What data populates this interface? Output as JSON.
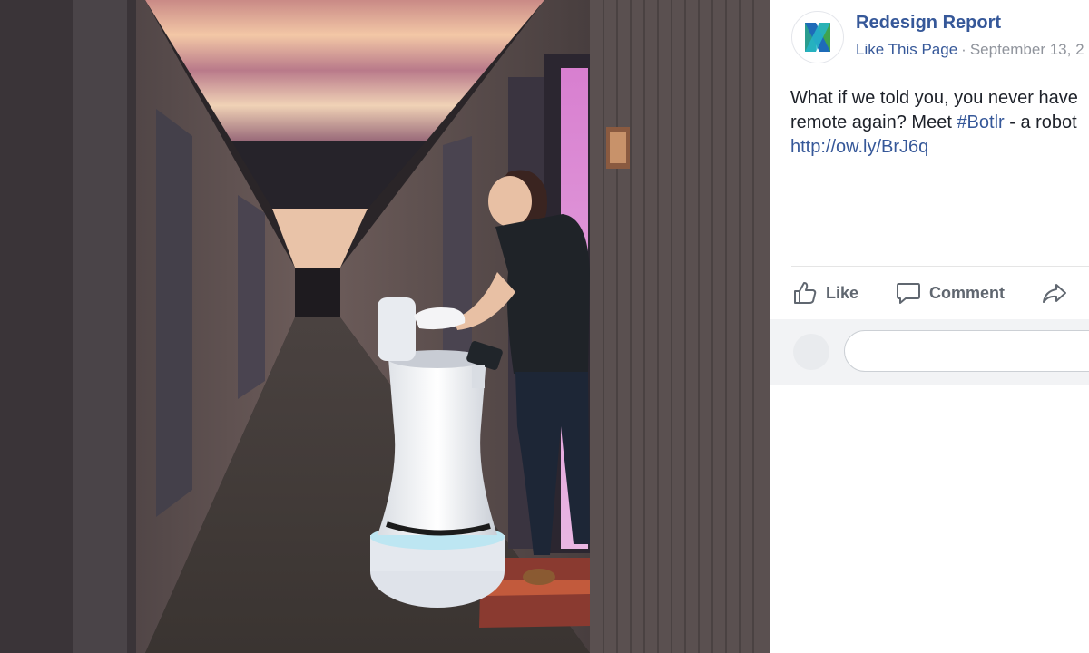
{
  "photo": {
    "description_icon": "hotel-hallway-robot-photo"
  },
  "post": {
    "page_name": "Redesign Report",
    "like_page_label": "Like This Page",
    "separator": "·",
    "date": "September 13, 2",
    "text_line1": "What if we told you, you never have",
    "text_line2_prefix": "remote again? Meet ",
    "hashtag": "#Botlr",
    "text_line2_suffix": " - a robot",
    "link": "http://ow.ly/BrJ6q"
  },
  "actions": {
    "like_label": "Like",
    "comment_label": "Comment",
    "like_icon": "thumbs-up-icon",
    "comment_icon": "speech-bubble-icon",
    "share_icon": "share-arrow-icon"
  },
  "comment_box": {
    "value": "",
    "placeholder": ""
  },
  "colors": {
    "link_blue": "#365899",
    "meta_gray": "#90949c",
    "action_gray": "#606770",
    "comment_bar_bg": "#f2f3f5"
  }
}
